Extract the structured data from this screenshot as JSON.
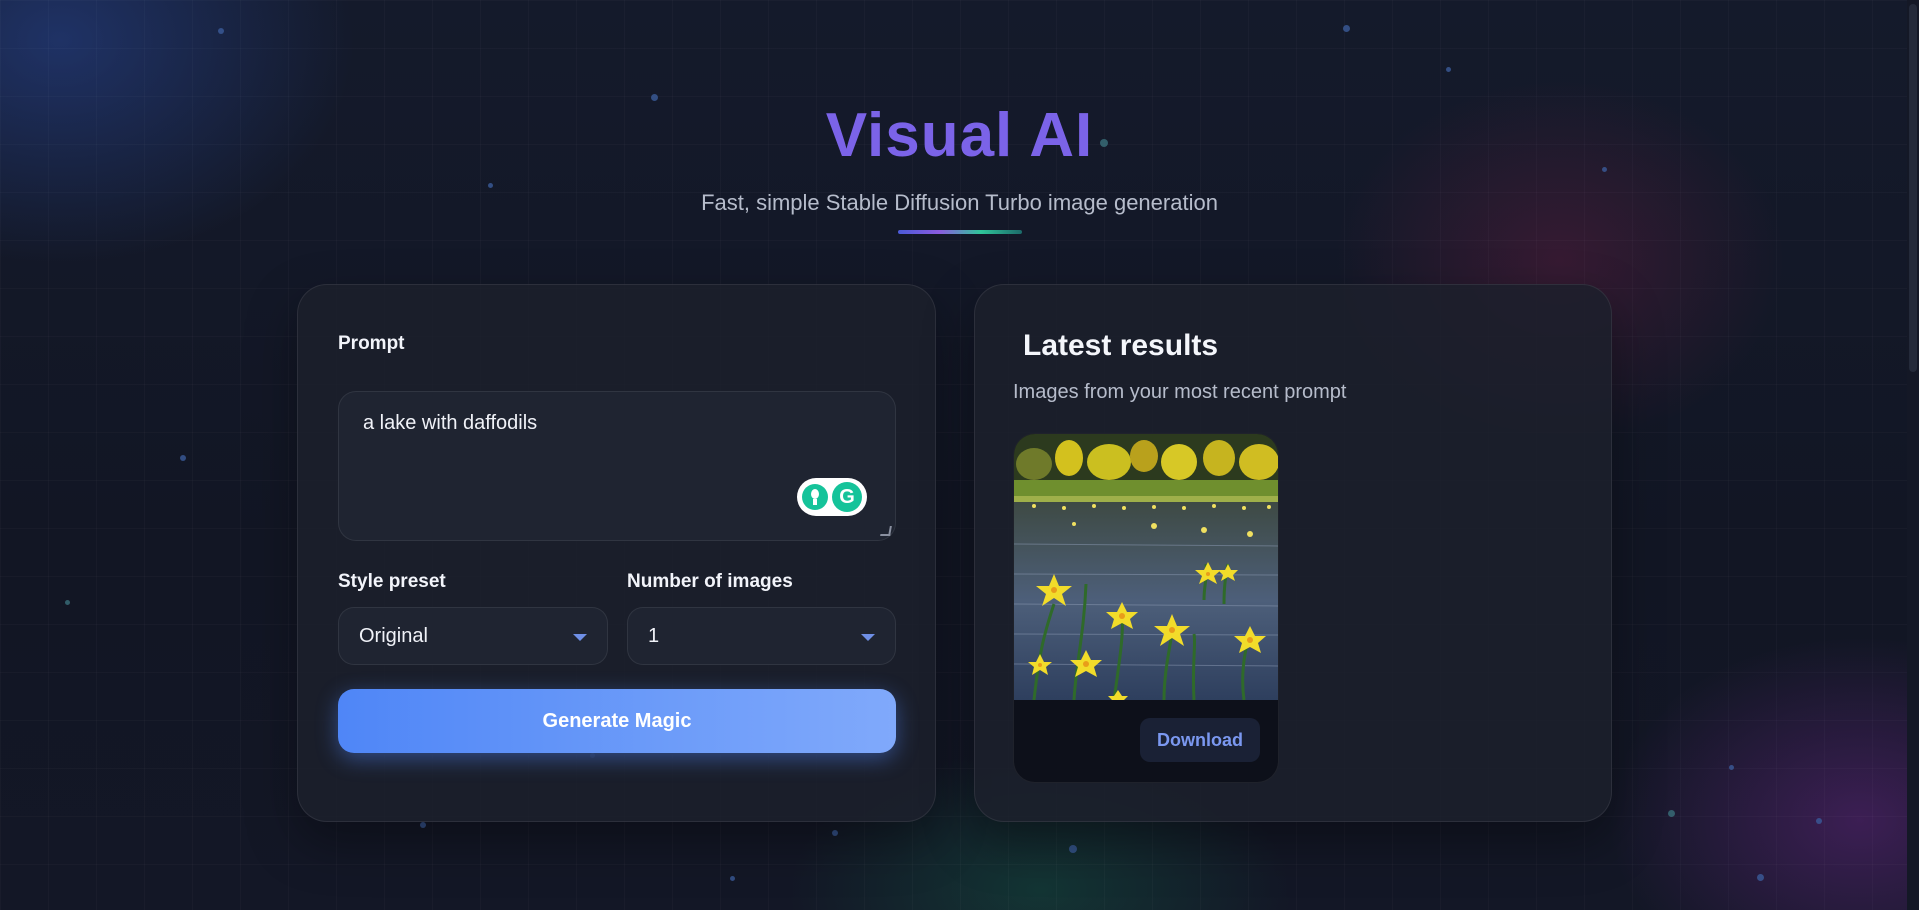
{
  "header": {
    "title": "Visual AI",
    "subtitle": "Fast, simple Stable Diffusion Turbo image generation"
  },
  "form": {
    "prompt_label": "Prompt",
    "prompt_value": "a lake with daffodils",
    "style_label": "Style preset",
    "style_value": "Original",
    "count_label": "Number of images",
    "count_value": "1",
    "generate_label": "Generate Magic"
  },
  "results": {
    "title": "Latest results",
    "subtitle": "Images from your most recent prompt",
    "download_label": "Download",
    "image_subject": "a lake with daffodils"
  },
  "colors": {
    "title": "#7b63e8",
    "button": "#5b8ff8",
    "download_text": "#7b98f0"
  }
}
